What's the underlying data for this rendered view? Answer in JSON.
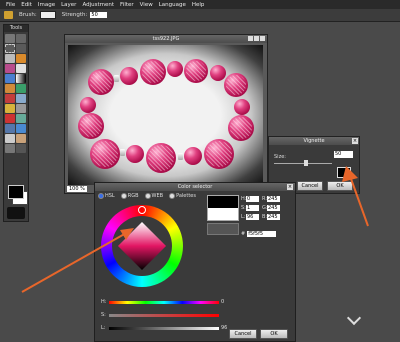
{
  "menu": [
    "File",
    "Edit",
    "Image",
    "Layer",
    "Adjustment",
    "Filter",
    "View",
    "Language",
    "Help"
  ],
  "options": {
    "brush_label": "Brush:",
    "strength_label": "Strength:",
    "strength_value": "50"
  },
  "tools": {
    "title": "Tools"
  },
  "image_window": {
    "title": "tss922.JPG",
    "zoom": "100 %"
  },
  "vignette": {
    "title": "Vignette",
    "size_label": "Size:",
    "size_value": "50",
    "cancel": "Cancel",
    "ok": "OK"
  },
  "color_selector": {
    "title": "Color selector",
    "tabs": [
      "HSL",
      "RGB",
      "WEB",
      "Palettes"
    ],
    "fields": [
      {
        "k": "H:",
        "v": "0",
        "k2": "R:",
        "v2": "245"
      },
      {
        "k": "S:",
        "v": "1",
        "k2": "G:",
        "v2": "245"
      },
      {
        "k": "L:",
        "v": "96",
        "k2": "B:",
        "v2": "245"
      }
    ],
    "hex_label": "#",
    "hex": "f5f5f5",
    "sliders": [
      {
        "k": "H:",
        "n": "0"
      },
      {
        "k": "S:",
        "n": ""
      },
      {
        "k": "L:",
        "n": "96"
      }
    ],
    "cancel": "Cancel",
    "ok": "OK"
  },
  "colors": {
    "accent_arrow": "#e8662a",
    "bead": "#e03878"
  }
}
